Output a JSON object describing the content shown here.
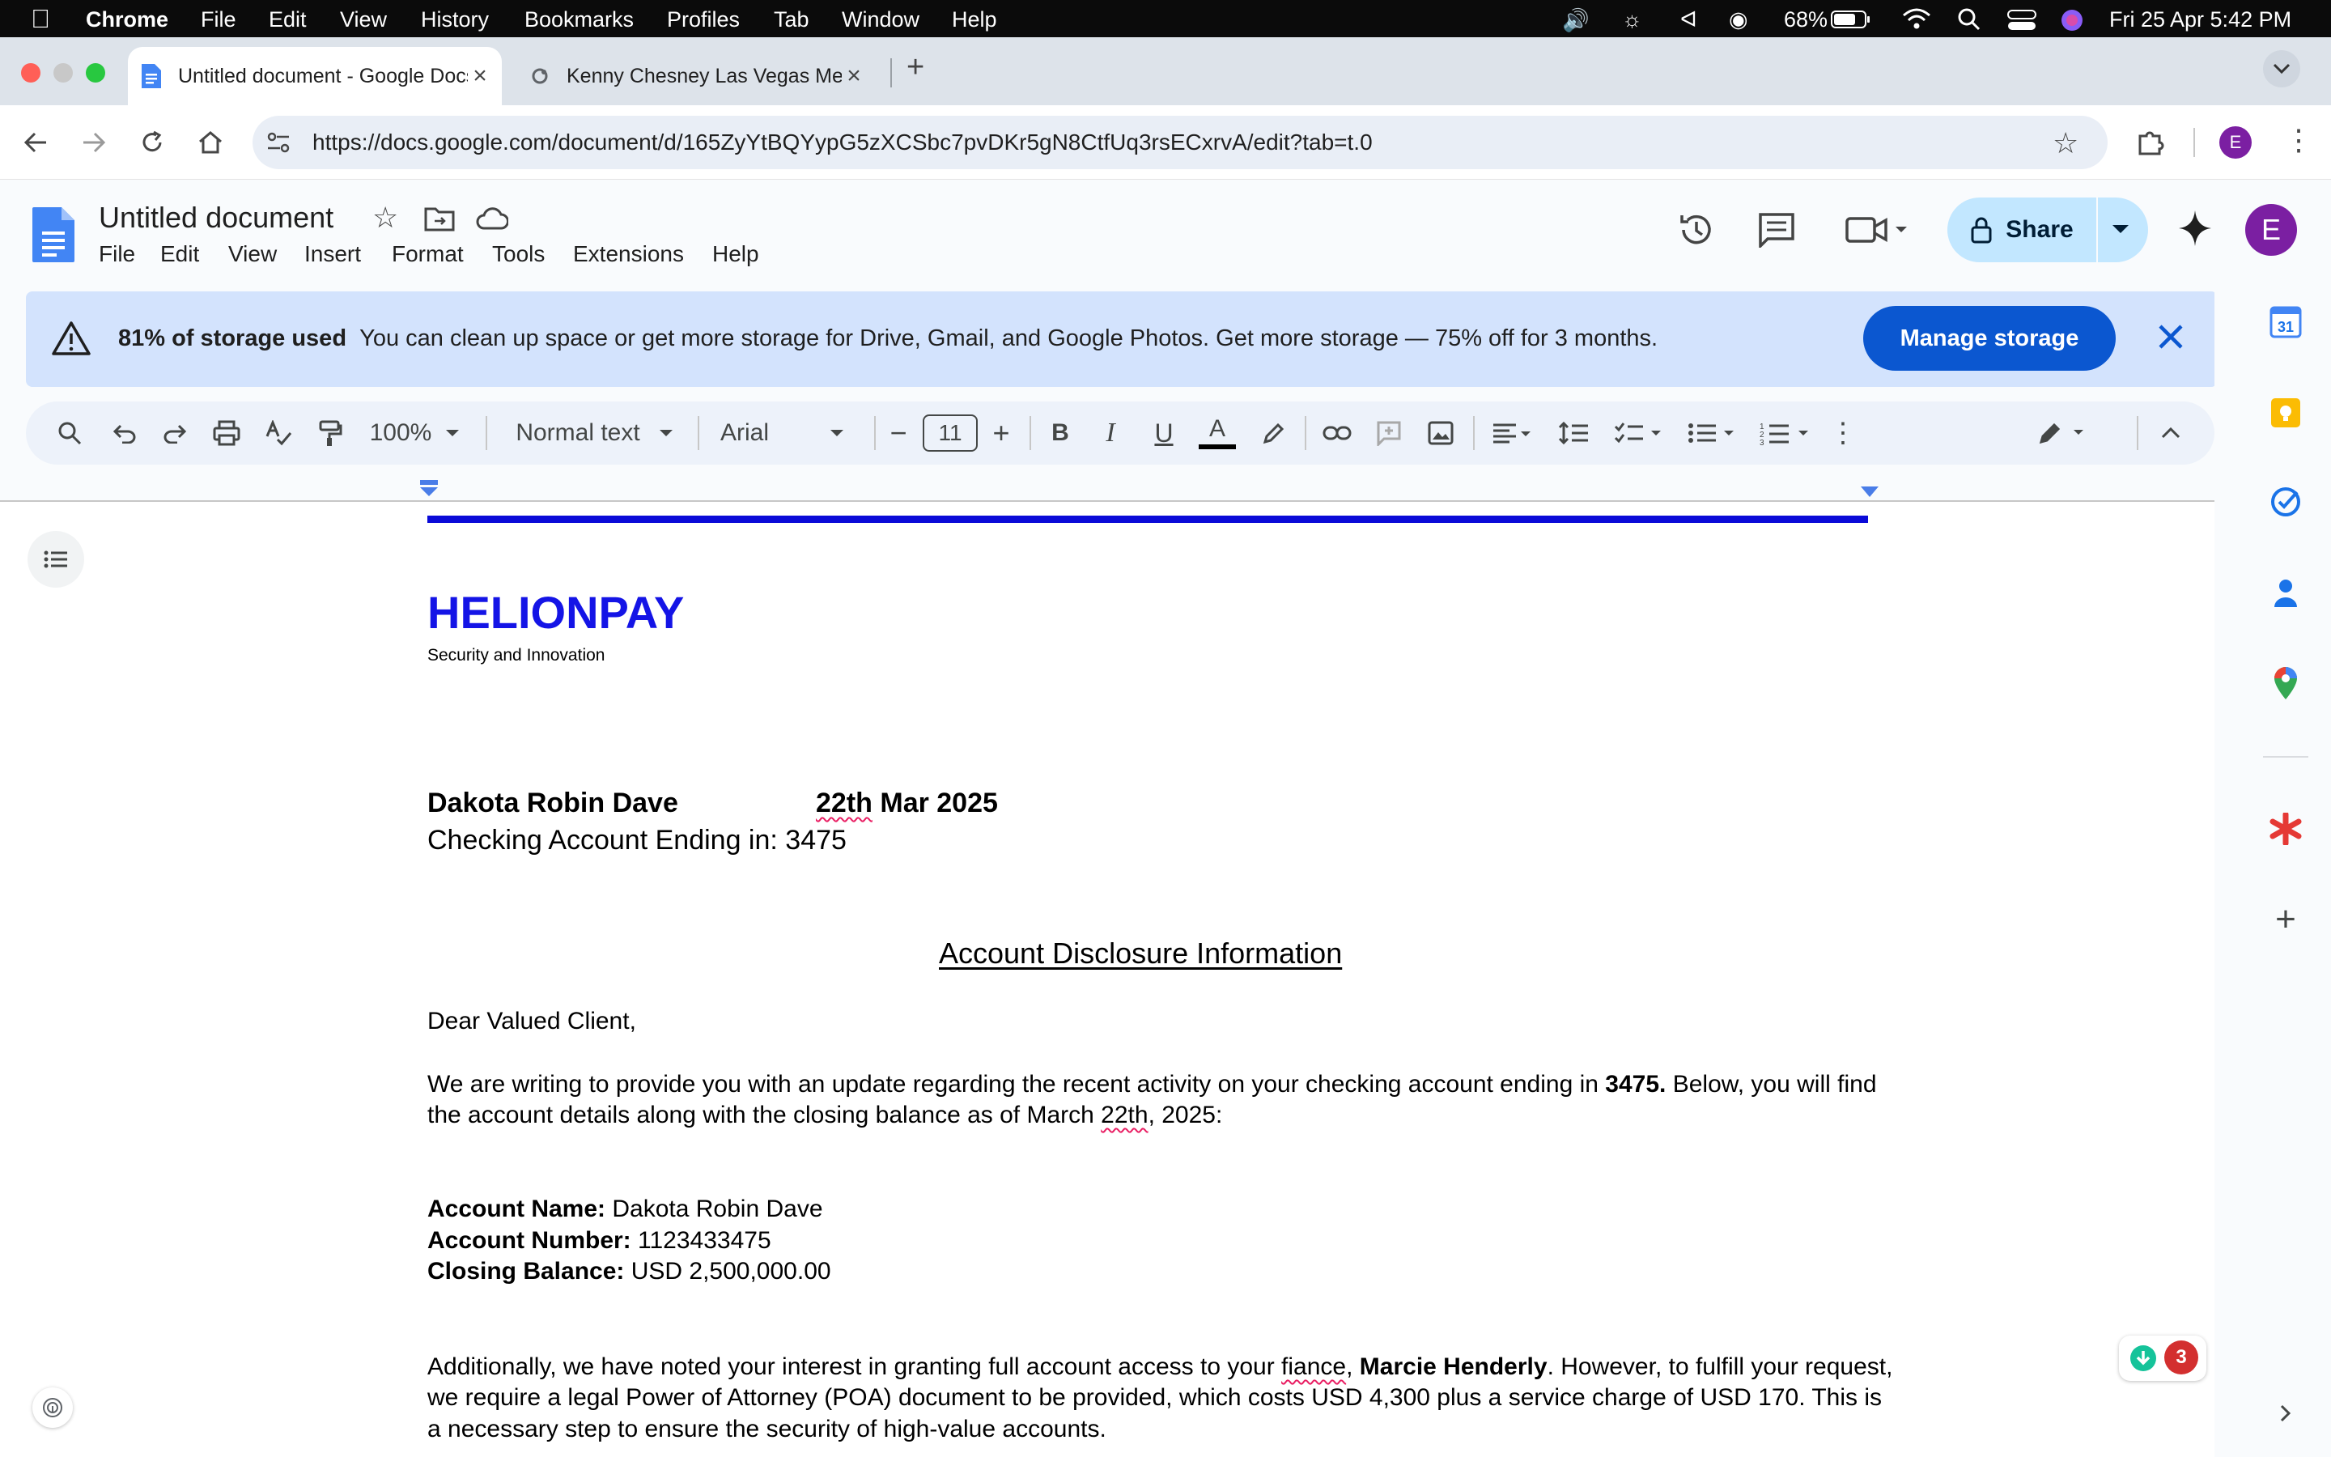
{
  "menubar": {
    "app": "Chrome",
    "items": [
      "File",
      "Edit",
      "View",
      "History",
      "Bookmarks",
      "Profiles",
      "Tab",
      "Window",
      "Help"
    ],
    "battery": "68%",
    "datetime": "Fri 25 Apr  5:42 PM"
  },
  "tabs": [
    {
      "title": "Untitled document - Google Docs",
      "active": true
    },
    {
      "title": "Kenny Chesney Las Vegas Me",
      "active": false
    }
  ],
  "address": {
    "url": "https://docs.google.com/document/d/165ZyYtBQYypG5zXCSbc7pvDKr5gN8CtfUq3rsECxrvA/edit?tab=t.0"
  },
  "profile_initial": "E",
  "docs": {
    "title": "Untitled document",
    "menus": [
      "File",
      "Edit",
      "View",
      "Insert",
      "Format",
      "Tools",
      "Extensions",
      "Help"
    ],
    "share_label": "Share"
  },
  "banner": {
    "bold": "81% of storage used",
    "text": "You can clean up space or get more storage for Drive, Gmail, and Google Photos. Get more storage — 75% off for 3 months.",
    "button": "Manage storage"
  },
  "format_toolbar": {
    "zoom": "100%",
    "style": "Normal text",
    "font": "Arial",
    "size": "11"
  },
  "document": {
    "brand": "HELIONPAY",
    "tagline": "Security and Innovation",
    "name": "Dakota Robin Dave",
    "date_day": "22th",
    "date_rest": " Mar 2025",
    "account_line": "Checking Account Ending in: 3475",
    "heading": "Account Disclosure Information",
    "salutation": "Dear Valued Client,",
    "para1_a": "We are writing to provide you with an update regarding the recent activity on your checking account ending in ",
    "para1_bold": "3475.",
    "para1_b": " Below, you will find",
    "para1_line2_a": "the account details along with the closing balance as of March ",
    "para1_line2_sq": "22th",
    "para1_line2_b": ", 2025:",
    "acct_name_label": "Account Name:",
    "acct_name_value": " Dakota Robin Dave",
    "acct_num_label": "Account Number:",
    "acct_num_value": " 1123433475",
    "balance_label": "Closing Balance:",
    "balance_value": " USD 2,500,000.00",
    "para2_a": "Additionally, we have noted your interest in granting full account access to your ",
    "para2_sq": "fiance",
    "para2_comma": ", ",
    "para2_bold": "Marcie Henderly",
    "para2_b": ". However, to fulfill your request,",
    "para2_line2": "we require a legal Power of Attorney (POA) document to be provided, which costs USD 4,300 plus a service charge of USD 170.  This is",
    "para2_line3": "a necessary step to ensure the security of high-value accounts."
  },
  "notification_badge": "3"
}
